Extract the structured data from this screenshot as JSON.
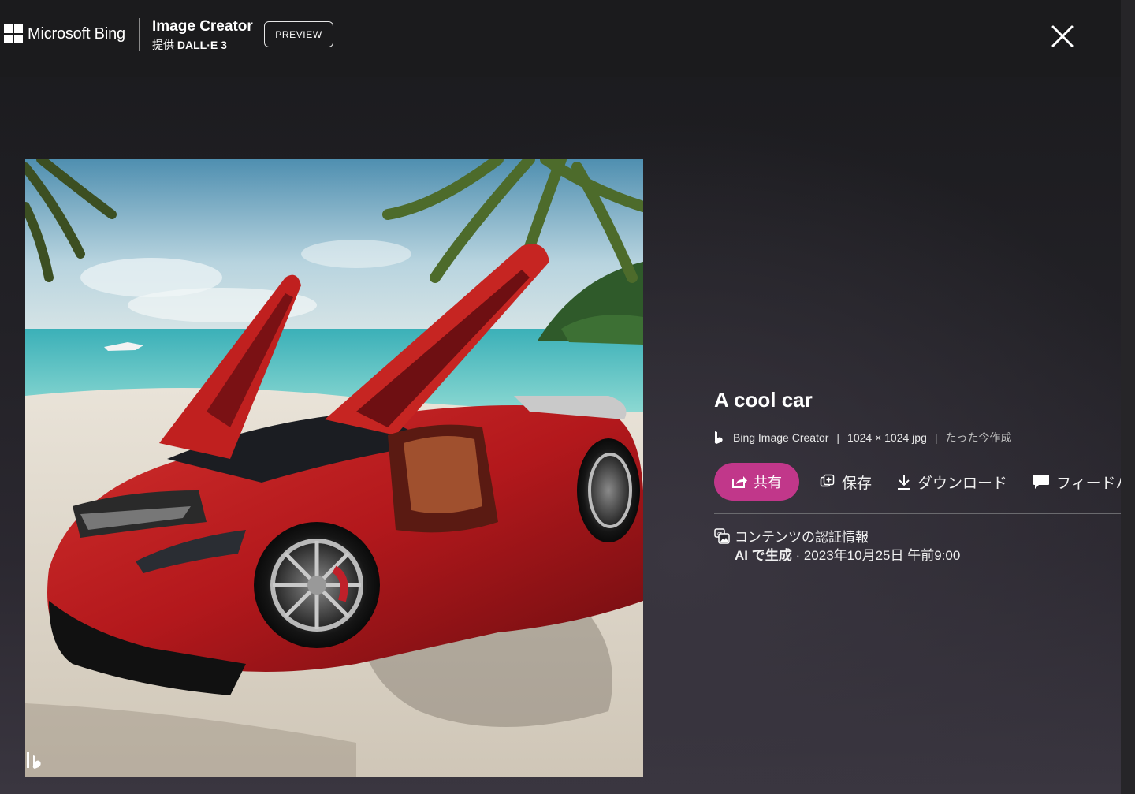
{
  "header": {
    "brand": "Microsoft Bing",
    "product_title": "Image Creator",
    "product_sub_prefix": "提供",
    "product_sub_model": "DALL·E 3",
    "preview_label": "PREVIEW",
    "close_icon": "close-icon"
  },
  "image": {
    "description_icon": "generated-car-image",
    "watermark_icon": "bing-logo-icon"
  },
  "details": {
    "title": "A cool car",
    "source": "Bing Image Creator",
    "dimensions": "1024 × 1024 jpg",
    "created": "たった今作成",
    "separator": "|"
  },
  "actions": {
    "share": "共有",
    "save": "保存",
    "download": "ダウンロード",
    "feedback": "フィードバ"
  },
  "credentials": {
    "title": "コンテンツの認証情報",
    "generated_by": "AI で生成",
    "timestamp": "· 2023年10月25日 午前9:00"
  },
  "colors": {
    "accent": "#c1378a",
    "background": "#1b1b1d",
    "car_red": "#b3181c"
  }
}
